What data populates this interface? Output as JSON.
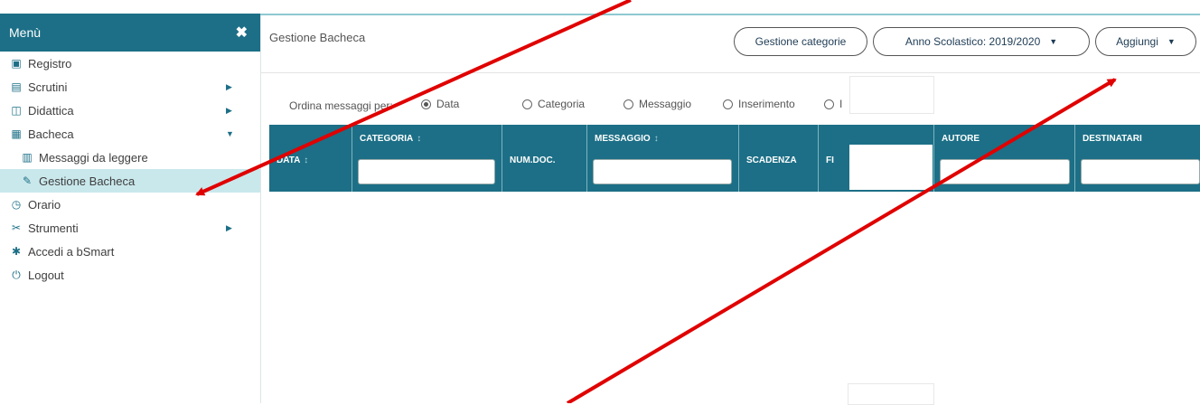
{
  "sidebar": {
    "title": "Menù",
    "close_icon": "✖",
    "items": [
      {
        "label": "Registro",
        "icon": "calendar-icon"
      },
      {
        "label": "Scrutini",
        "icon": "document-icon"
      },
      {
        "label": "Didattica",
        "icon": "book-icon"
      },
      {
        "label": "Bacheca",
        "icon": "board-icon"
      },
      {
        "label": "Messaggi da leggere",
        "icon": "messages-icon"
      },
      {
        "label": "Gestione Bacheca",
        "icon": "edit-icon"
      },
      {
        "label": "Orario",
        "icon": "clock-icon"
      },
      {
        "label": "Strumenti",
        "icon": "tools-icon"
      },
      {
        "label": "Accedi a bSmart",
        "icon": "star-icon"
      },
      {
        "label": "Logout",
        "icon": "logout-icon"
      }
    ]
  },
  "main": {
    "title": "Gestione Bacheca",
    "buttons": {
      "categories": "Gestione categorie",
      "school_year": "Anno Scolastico: 2019/2020",
      "add": "Aggiungi"
    },
    "order": {
      "label": "Ordina messaggi per:",
      "options": [
        "Data",
        "Categoria",
        "Messaggio",
        "Inserimento",
        "I"
      ],
      "selected": "Data"
    }
  },
  "table": {
    "columns": [
      "DATA",
      "CATEGORIA",
      "NUM.DOC.",
      "MESSAGGIO",
      "SCADENZA",
      "FI",
      "AUTORE",
      "DESTINATARI"
    ]
  },
  "colors": {
    "accent": "#1c6f86",
    "active_bg": "#c9e8ec",
    "arrow": "#e00000"
  }
}
